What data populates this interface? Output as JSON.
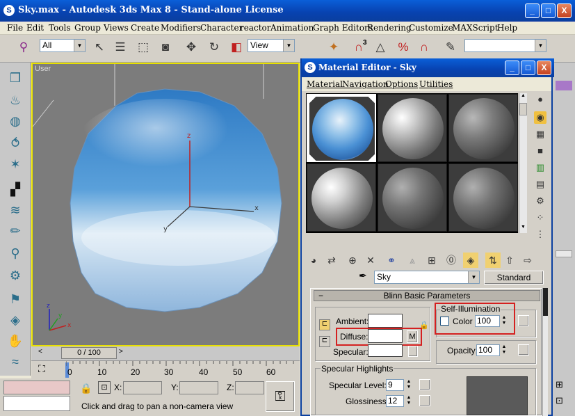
{
  "window": {
    "title": "Sky.max - Autodesk 3ds Max 8  - Stand-alone License",
    "minimize": "_",
    "maximize": "□",
    "close": "X"
  },
  "menu": [
    "File",
    "Edit",
    "Tools",
    "Group",
    "Views",
    "Create",
    "Modifiers",
    "Character",
    "reactor",
    "Animation",
    "Graph Editors",
    "Rendering",
    "Customize",
    "MAXScript",
    "Help"
  ],
  "toolbar": {
    "selection_filter": "All",
    "reference_coord": "View",
    "snap_labels": [
      "3",
      "n"
    ],
    "named_selection": ""
  },
  "viewport": {
    "label": "User",
    "axis_labels": {
      "z": "z",
      "x": "x",
      "y": "y"
    }
  },
  "timeline": {
    "frame_counter": "0 / 100",
    "ticks": [
      "0",
      "10",
      "20",
      "30",
      "40",
      "50",
      "60"
    ]
  },
  "status": {
    "x_label": "X:",
    "y_label": "Y:",
    "z_label": "Z:",
    "x_value": "",
    "y_value": "",
    "z_value": "",
    "prompt": "Click and drag to pan a non-camera view"
  },
  "material_editor": {
    "title": "Material Editor - Sky",
    "menu": [
      "Material",
      "Navigation",
      "Options",
      "Utilities"
    ],
    "material_name": "Sky",
    "material_type": "Standard",
    "rollout_title": "Blinn Basic Parameters",
    "ambient_label": "Ambient:",
    "diffuse_label": "Diffuse:",
    "specular_label": "Specular:",
    "map_button": "M",
    "self_illum": {
      "group_label": "Self-Illumination",
      "color_label": "Color",
      "value": "100"
    },
    "opacity": {
      "label": "Opacity:",
      "value": "100"
    },
    "specular_highlights": {
      "group_label": "Specular Highlights",
      "level_label": "Specular Level:",
      "level_value": "9",
      "gloss_label": "Glossiness:",
      "gloss_value": "12"
    },
    "colors": {
      "highlight_box": "#D42020",
      "sky_top": "#2E7AC4",
      "sky_bottom": "#E8F2FA"
    }
  }
}
